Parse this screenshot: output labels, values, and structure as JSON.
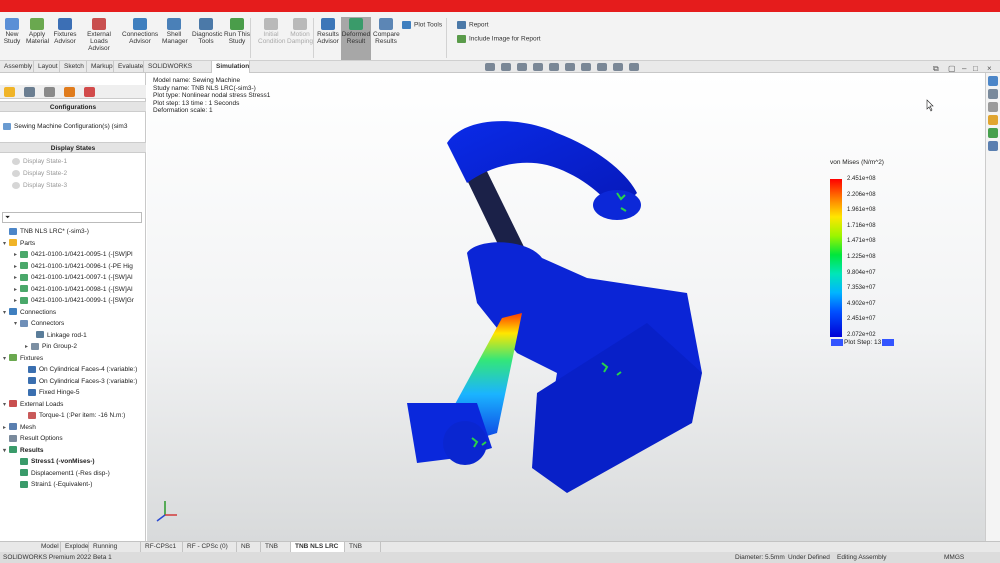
{
  "ribbon": {
    "buttons": [
      {
        "label": "New\nStudy",
        "icon": "new-study-icon",
        "color": "#5a8fd6"
      },
      {
        "label": "Apply\nMaterial",
        "icon": "apply-material-icon",
        "color": "#6aa84f"
      },
      {
        "label": "Fixtures\nAdvisor",
        "icon": "fixtures-advisor-icon",
        "color": "#3c6fb5"
      },
      {
        "label": "External Loads\nAdvisor",
        "icon": "external-loads-icon",
        "color": "#c94f4f"
      },
      {
        "label": "Connections\nAdvisor",
        "icon": "connections-advisor-icon",
        "color": "#3f7fbf"
      },
      {
        "label": "Shell\nManager",
        "icon": "shell-manager-icon",
        "color": "#4a80b8"
      },
      {
        "label": "Diagnostic\nTools",
        "icon": "diagnostic-tools-icon",
        "color": "#4b79a8"
      },
      {
        "label": "Run This\nStudy",
        "icon": "run-study-icon",
        "color": "#4a9d4a"
      },
      {
        "label": "Initial\nCondition",
        "icon": "initial-condition-icon",
        "color": "#b9b9b9"
      },
      {
        "label": "Motion\nDamping",
        "icon": "motion-damping-icon",
        "color": "#b9b9b9"
      },
      {
        "label": "Results\nAdvisor",
        "icon": "results-advisor-icon",
        "color": "#3c76b8"
      },
      {
        "label": "Deformed\nResult",
        "icon": "deformed-result-icon",
        "color": "#3a9b6a"
      },
      {
        "label": "Compare\nResults",
        "icon": "compare-results-icon",
        "color": "#5c86b5"
      }
    ],
    "plot_tools": "Plot Tools",
    "report": "Report",
    "include_image": "Include Image for Report"
  },
  "tabs": [
    "Assembly",
    "Layout",
    "Sketch",
    "Markup",
    "Evaluate",
    "SOLIDWORKS Add-Ins",
    "Simulation"
  ],
  "left_panel": {
    "configurations_title": "Configurations",
    "config_item": "Sewing Machine Configuration(s) (sim3",
    "display_states_title": "Display States",
    "display_states": [
      "Display State-1",
      "Display State-2",
      "Display State-3"
    ],
    "tree": {
      "root": "TNB NLS LRC* (-sim3-)",
      "parts_label": "Parts",
      "parts": [
        "0421-0100-1/0421-0095-1 (-[SW]Pl",
        "0421-0100-1/0421-0096-1 (-PE Hig",
        "0421-0100-1/0421-0097-1 (-[SW]Al",
        "0421-0100-1/0421-0098-1 (-[SW]Al",
        "0421-0100-1/0421-0099-1 (-[SW]Gr"
      ],
      "connections_label": "Connections",
      "connectors_label": "Connectors",
      "connectors": [
        "Linkage rod-1"
      ],
      "pin_group": "Pin Group-2",
      "fixtures_label": "Fixtures",
      "fixtures": [
        "On Cylindrical Faces-4 (:variable:)",
        "On Cylindrical Faces-3 (:variable:)",
        "Fixed Hinge-5"
      ],
      "external_loads_label": "External Loads",
      "external_loads": [
        "Torque-1 (:Per item: -16 N.m:)"
      ],
      "mesh_label": "Mesh",
      "result_options_label": "Result Options",
      "results_label": "Results",
      "results": [
        "Stress1 (-vonMises-)",
        "Displacement1 (-Res disp-)",
        "Strain1 (-Equivalent-)"
      ]
    }
  },
  "viewport": {
    "info_lines": [
      "Model name: Sewing Machine",
      "Study name: TNB NLS LRC(-sim3-)",
      "Plot type: Nonlinear nodal stress Stress1",
      "Plot step: 13   time : 1 Seconds",
      "Deformation scale: 1"
    ],
    "legend": {
      "title": "von Mises (N/m^2)",
      "labels": [
        "2.451e+08",
        "2.206e+08",
        "1.961e+08",
        "1.716e+08",
        "1.471e+08",
        "1.225e+08",
        "9.804e+07",
        "7.353e+07",
        "4.902e+07",
        "2.451e+07",
        "2.072e+02"
      ],
      "footer": "Plot Step: 13"
    }
  },
  "bottom_tabs": [
    "Model",
    "Explode",
    "Running motion",
    "RF-CPSc1",
    "RF - CPSc (0)",
    "NB",
    "TNB LS",
    "TNB NLS LRC",
    "TNB NLS"
  ],
  "status": {
    "app": "SOLIDWORKS Premium 2022 Beta 1",
    "diameter": "Diameter: 5.5mm",
    "under_defined": "Under Defined",
    "editing": "Editing Assembly",
    "units": "MMGS"
  }
}
